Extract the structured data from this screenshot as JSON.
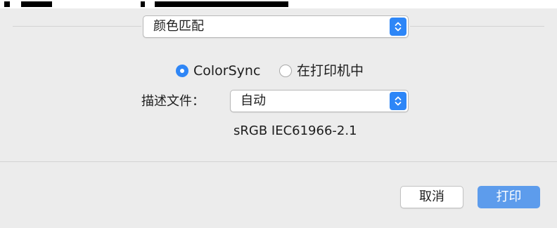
{
  "section_popup": {
    "value": "颜色匹配"
  },
  "color_matching": {
    "option_colorsync": "ColorSync",
    "option_in_printer": "在打印机中",
    "selected": "ColorSync"
  },
  "profile": {
    "label": "描述文件：",
    "value": "自动",
    "info": "sRGB IEC61966-2.1"
  },
  "buttons": {
    "cancel": "取消",
    "print": "打印"
  },
  "colors": {
    "accent": "#2f86f6",
    "primary_button": "#5d9cec",
    "background": "#ececec"
  }
}
